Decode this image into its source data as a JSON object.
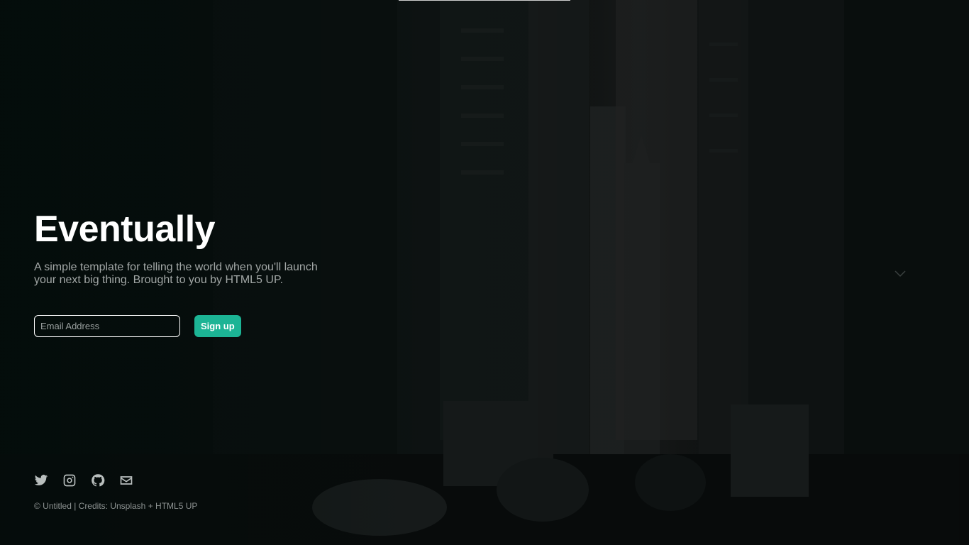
{
  "hero": {
    "title": "Eventually",
    "description": "A simple template for telling the world when you'll launch your next big thing. Brought to you by HTML5 UP."
  },
  "signup": {
    "email_placeholder": "Email Address",
    "submit_label": "Sign up"
  },
  "footer": {
    "social": [
      {
        "name": "twitter-icon"
      },
      {
        "name": "instagram-icon"
      },
      {
        "name": "github-icon"
      },
      {
        "name": "envelope-icon"
      }
    ],
    "copyright": "© Untitled | Credits: Unsplash + HTML5 UP"
  },
  "colors": {
    "accent": "#1cb495",
    "title": "#ffffff",
    "text": "#a2a7a6"
  }
}
